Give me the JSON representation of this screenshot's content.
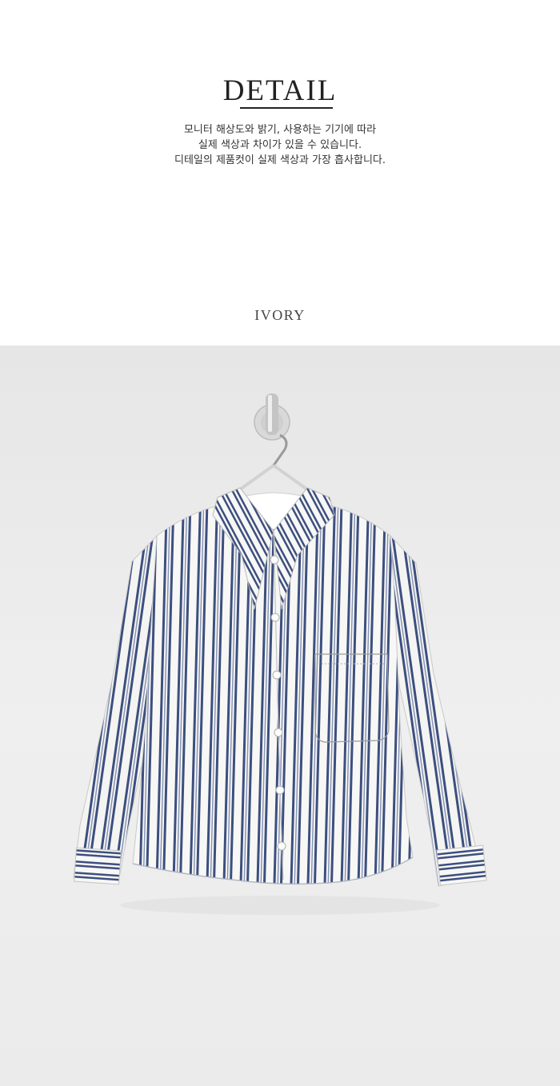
{
  "header": {
    "title": "DETAIL"
  },
  "notice": {
    "lines": [
      "모니터 해상도와 밝기, 사용하는 기기에 따라",
      "실제 색상과 차이가 있을 수 있습니다.",
      "디테일의 제품컷이 실제 색상과 가장 흡사합니다."
    ]
  },
  "color_option": {
    "label": "IVORY"
  },
  "product_photo": {
    "subject": "striped-shirt",
    "colors": {
      "background": "#ececec",
      "shirt": "#f7f7f5",
      "stripe": "#3d4f7f"
    }
  }
}
